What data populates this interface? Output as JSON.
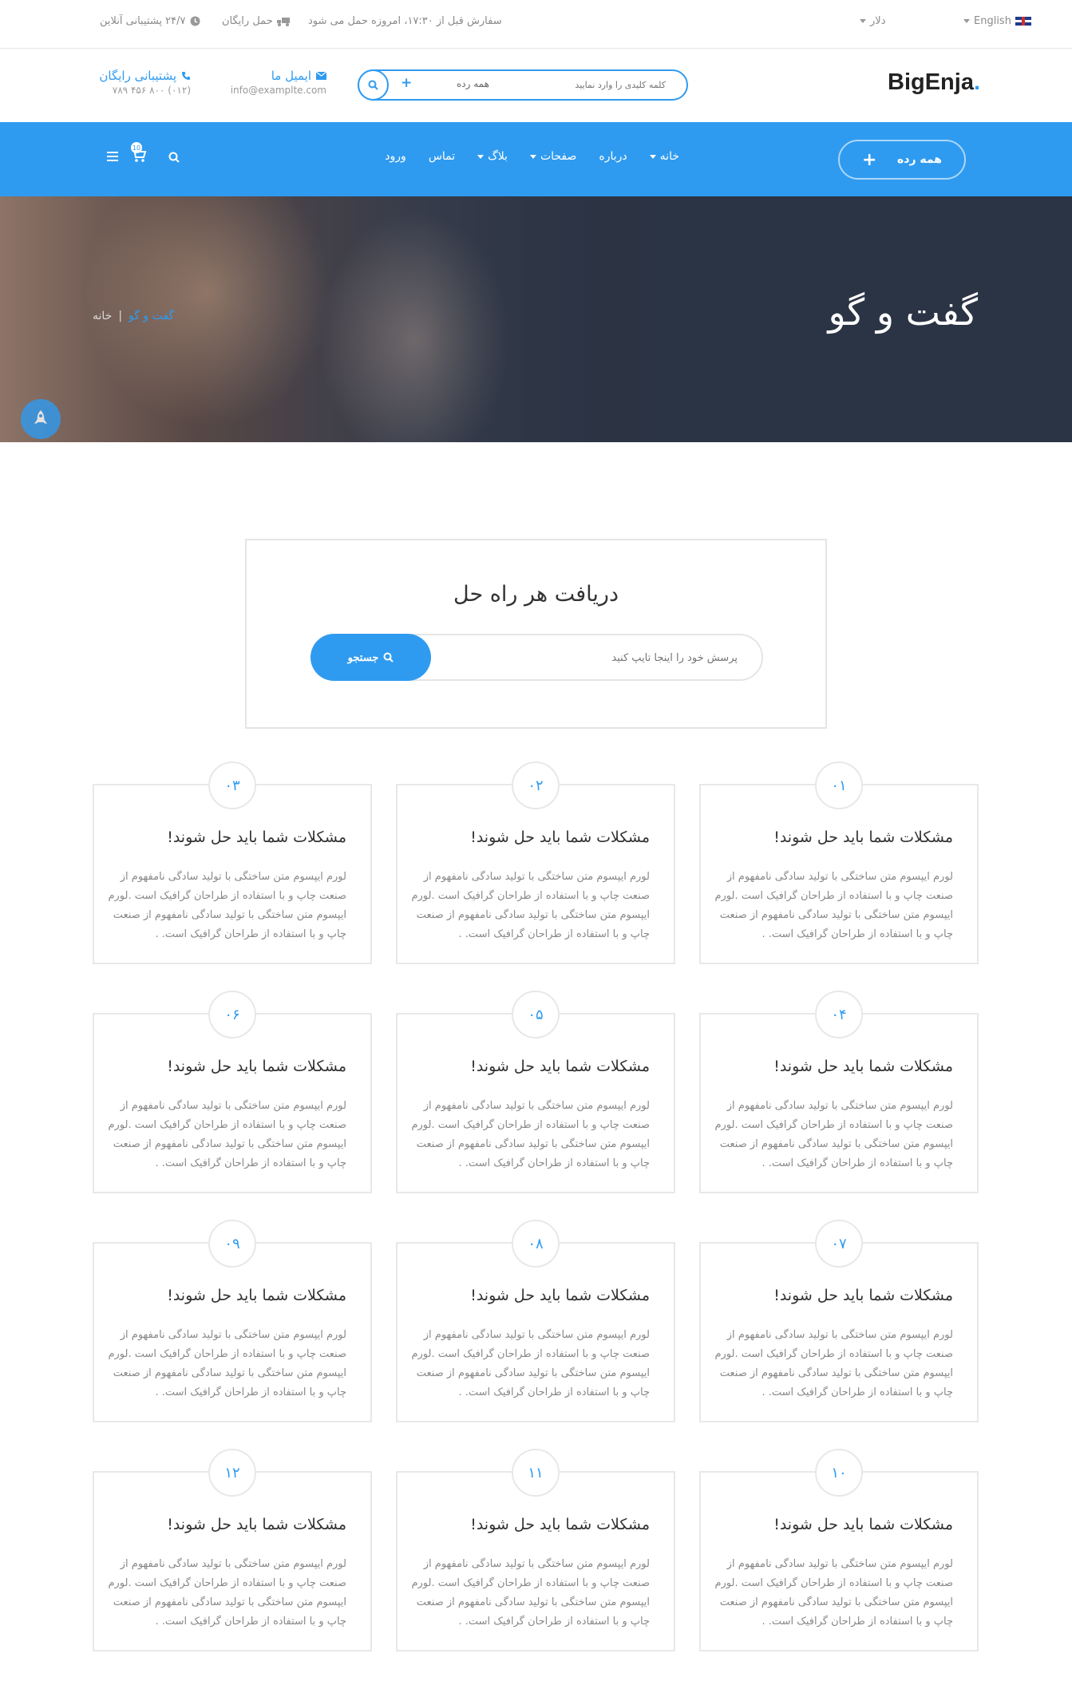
{
  "topbar": {
    "language": "English",
    "currency": "دلار",
    "shipping": "سفارش قبل از ۱۷:۳۰، امروزه حمل می شود",
    "free_shipping": "حمل رایگان",
    "support": "۲۴/۷ پشتیبانی آنلاین"
  },
  "header": {
    "logo": "BigEnja",
    "logo_dot": ".",
    "search_placeholder": "کلمه کلیدی را وارد نمایید",
    "search_category": "همه رده",
    "email_label": "ایمیل ما",
    "email_value": "info@examplte.com",
    "support_label": "پشتیبانی رایگان",
    "support_phone": "(۰۱۲) ۸۰۰ ۴۵۶ ۷۸۹"
  },
  "nav": {
    "category_button": "همه رده",
    "links": [
      "خانه",
      "درباره",
      "صفحات",
      "بلاگ",
      "تماس",
      "ورود"
    ],
    "cart_count": "10"
  },
  "hero": {
    "title": "گفت و گو",
    "breadcrumb_home": "خانه",
    "breadcrumb_sep": "|",
    "breadcrumb_current": "گفت و گو"
  },
  "help": {
    "heading": "دریافت هر راه حل",
    "placeholder": "پرسش خود را اینجا تایپ کنید",
    "button": "جستجو"
  },
  "cards": [
    {
      "num": "۰۱",
      "title": "مشکلات شما باید حل شوند!",
      "body": "لورم ایپسوم متن ساختگی با تولید سادگی نامفهوم از صنعت چاپ و با استفاده از طراحان گرافیک است .لورم ایپسوم متن ساختگی با تولید سادگی نامفهوم از صنعت چاپ و با استفاده از طراحان گرافیک است. ."
    },
    {
      "num": "۰۲",
      "title": "مشکلات شما باید حل شوند!",
      "body": "لورم ایپسوم متن ساختگی با تولید سادگی نامفهوم از صنعت چاپ و با استفاده از طراحان گرافیک است .لورم ایپسوم متن ساختگی با تولید سادگی نامفهوم از صنعت چاپ و با استفاده از طراحان گرافیک است. ."
    },
    {
      "num": "۰۳",
      "title": "مشکلات شما باید حل شوند!",
      "body": "لورم ایپسوم متن ساختگی با تولید سادگی نامفهوم از صنعت چاپ و با استفاده از طراحان گرافیک است .لورم ایپسوم متن ساختگی با تولید سادگی نامفهوم از صنعت چاپ و با استفاده از طراحان گرافیک است. ."
    },
    {
      "num": "۰۴",
      "title": "مشکلات شما باید حل شوند!",
      "body": "لورم ایپسوم متن ساختگی با تولید سادگی نامفهوم از صنعت چاپ و با استفاده از طراحان گرافیک است .لورم ایپسوم متن ساختگی با تولید سادگی نامفهوم از صنعت چاپ و با استفاده از طراحان گرافیک است. ."
    },
    {
      "num": "۰۵",
      "title": "مشکلات شما باید حل شوند!",
      "body": "لورم ایپسوم متن ساختگی با تولید سادگی نامفهوم از صنعت چاپ و با استفاده از طراحان گرافیک است .لورم ایپسوم متن ساختگی با تولید سادگی نامفهوم از صنعت چاپ و با استفاده از طراحان گرافیک است. ."
    },
    {
      "num": "۰۶",
      "title": "مشکلات شما باید حل شوند!",
      "body": "لورم ایپسوم متن ساختگی با تولید سادگی نامفهوم از صنعت چاپ و با استفاده از طراحان گرافیک است .لورم ایپسوم متن ساختگی با تولید سادگی نامفهوم از صنعت چاپ و با استفاده از طراحان گرافیک است. ."
    },
    {
      "num": "۰۷",
      "title": "مشکلات شما باید حل شوند!",
      "body": "لورم ایپسوم متن ساختگی با تولید سادگی نامفهوم از صنعت چاپ و با استفاده از طراحان گرافیک است .لورم ایپسوم متن ساختگی با تولید سادگی نامفهوم از صنعت چاپ و با استفاده از طراحان گرافیک است. ."
    },
    {
      "num": "۰۸",
      "title": "مشکلات شما باید حل شوند!",
      "body": "لورم ایپسوم متن ساختگی با تولید سادگی نامفهوم از صنعت چاپ و با استفاده از طراحان گرافیک است .لورم ایپسوم متن ساختگی با تولید سادگی نامفهوم از صنعت چاپ و با استفاده از طراحان گرافیک است. ."
    },
    {
      "num": "۰۹",
      "title": "مشکلات شما باید حل شوند!",
      "body": "لورم ایپسوم متن ساختگی با تولید سادگی نامفهوم از صنعت چاپ و با استفاده از طراحان گرافیک است .لورم ایپسوم متن ساختگی با تولید سادگی نامفهوم از صنعت چاپ و با استفاده از طراحان گرافیک است. ."
    },
    {
      "num": "۱۰",
      "title": "مشکلات شما باید حل شوند!",
      "body": "لورم ایپسوم متن ساختگی با تولید سادگی نامفهوم از صنعت چاپ و با استفاده از طراحان گرافیک است .لورم ایپسوم متن ساختگی با تولید سادگی نامفهوم از صنعت چاپ و با استفاده از طراحان گرافیک است. ."
    },
    {
      "num": "۱۱",
      "title": "مشکلات شما باید حل شوند!",
      "body": "لورم ایپسوم متن ساختگی با تولید سادگی نامفهوم از صنعت چاپ و با استفاده از طراحان گرافیک است .لورم ایپسوم متن ساختگی با تولید سادگی نامفهوم از صنعت چاپ و با استفاده از طراحان گرافیک است. ."
    },
    {
      "num": "۱۲",
      "title": "مشکلات شما باید حل شوند!",
      "body": "لورم ایپسوم متن ساختگی با تولید سادگی نامفهوم از صنعت چاپ و با استفاده از طراحان گرافیک است .لورم ایپسوم متن ساختگی با تولید سادگی نامفهوم از صنعت چاپ و با استفاده از طراحان گرافیک است. ."
    }
  ]
}
